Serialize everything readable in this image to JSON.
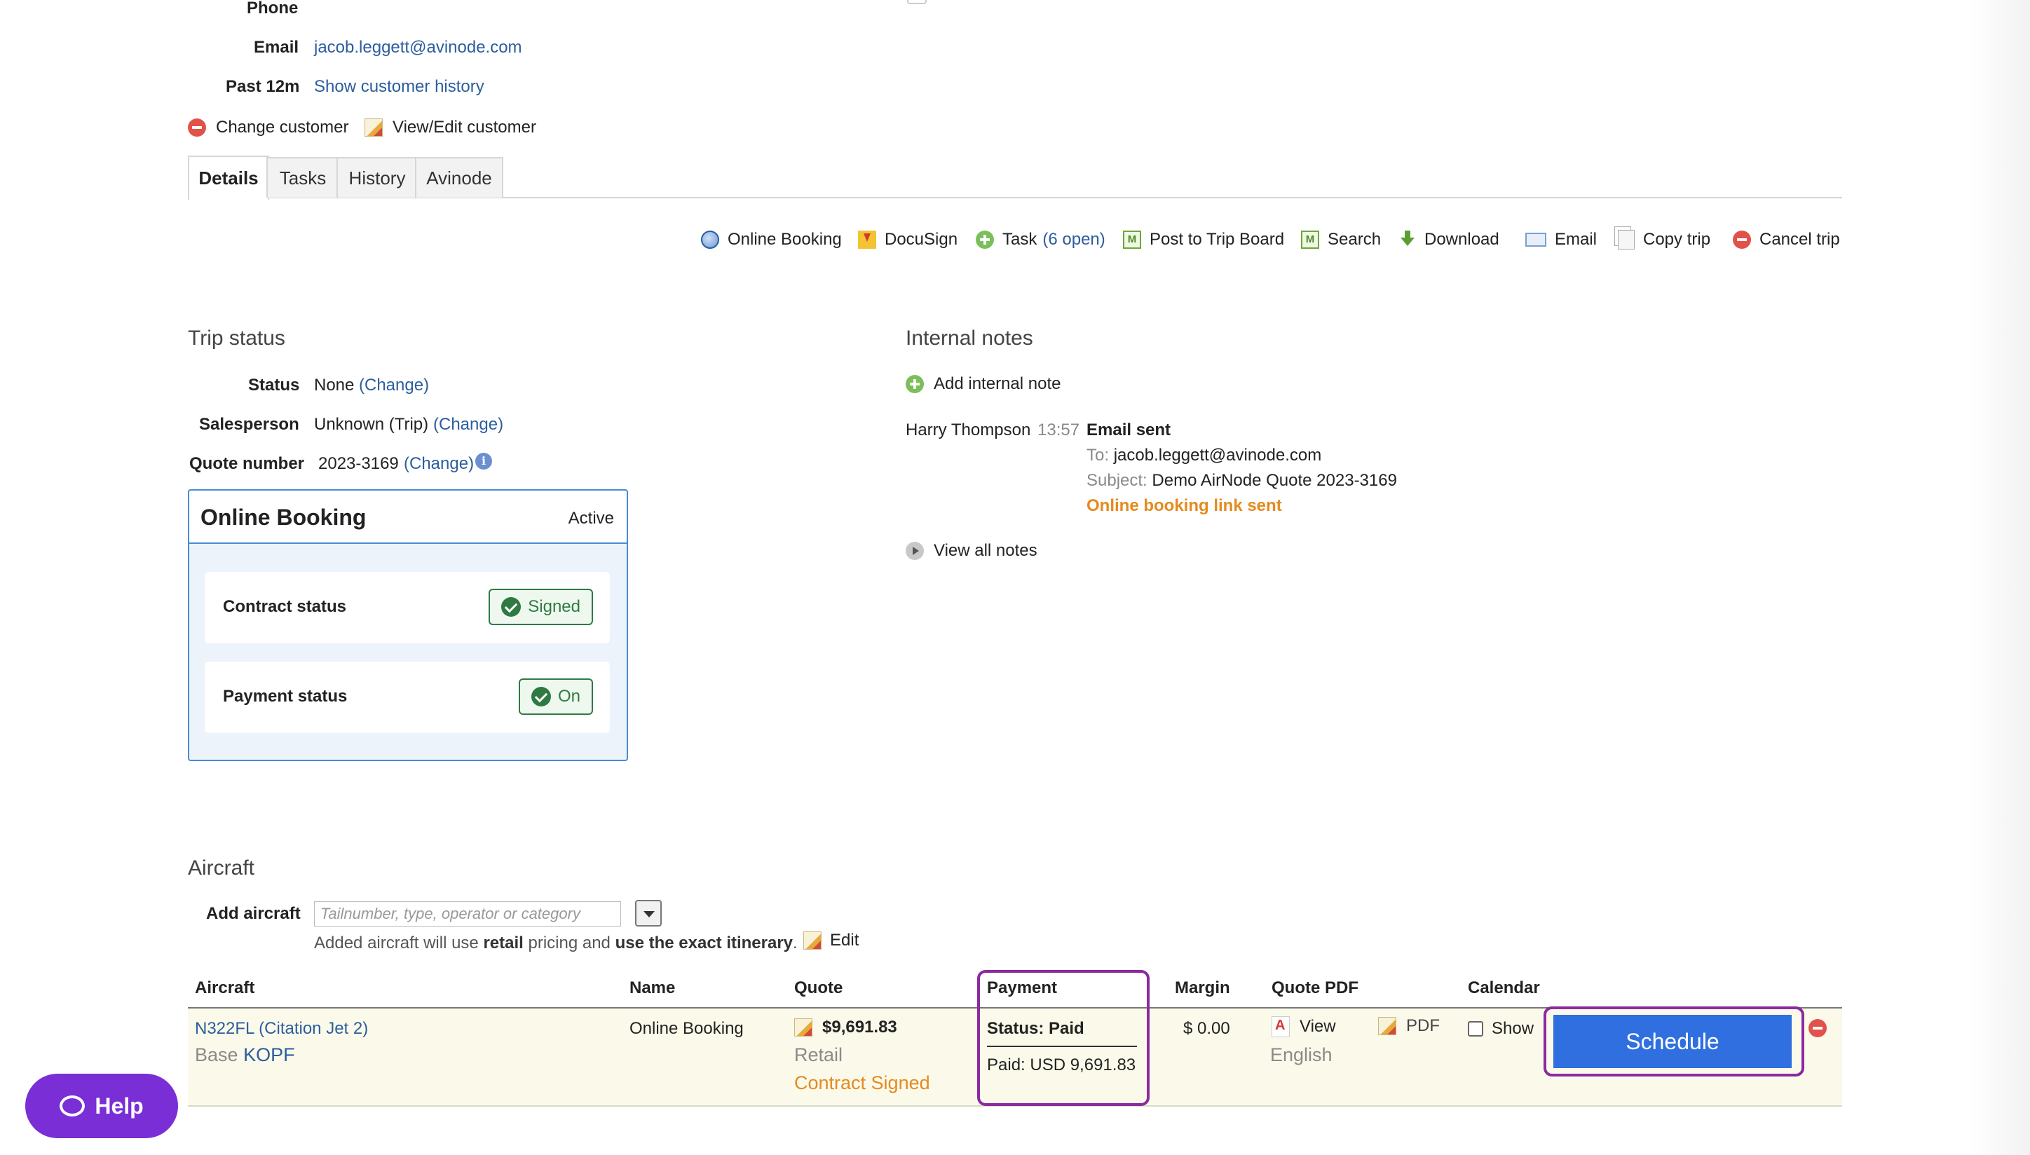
{
  "customer": {
    "phone_label": "Phone",
    "email_label": "Email",
    "email_value": "jacob.leggett@avinode.com",
    "past_label": "Past 12m",
    "history_link": "Show customer history",
    "change_customer": "Change customer",
    "view_edit_customer": "View/Edit customer"
  },
  "tabs": [
    {
      "label": "Details"
    },
    {
      "label": "Tasks"
    },
    {
      "label": "History"
    },
    {
      "label": "Avinode"
    }
  ],
  "toolbar": {
    "online_booking": "Online Booking",
    "docusign": "DocuSign",
    "task": "Task",
    "task_open": "(6 open)",
    "post_trip_board": "Post to Trip Board",
    "search": "Search",
    "download": "Download",
    "email": "Email",
    "copy_trip": "Copy trip",
    "cancel_trip": "Cancel trip"
  },
  "trip_status": {
    "heading": "Trip status",
    "status_label": "Status",
    "status_value": "None",
    "change": "(Change)",
    "salesperson_label": "Salesperson",
    "salesperson_value": "Unknown (Trip)",
    "quote_label": "Quote number",
    "quote_value": "2023-3169"
  },
  "online_booking": {
    "title": "Online Booking",
    "state": "Active",
    "contract_label": "Contract status",
    "contract_value": "Signed",
    "payment_label": "Payment status",
    "payment_value": "On"
  },
  "internal_notes": {
    "heading": "Internal notes",
    "add_note": "Add internal note",
    "author": "Harry Thompson",
    "time": "13:57",
    "note_title": "Email sent",
    "to_label": "To:",
    "to_value": "jacob.leggett@avinode.com",
    "subject_label": "Subject:",
    "subject_value": "Demo AirNode Quote 2023-3169",
    "status_note": "Online booking link sent",
    "view_all": "View all notes"
  },
  "aircraft": {
    "heading": "Aircraft",
    "add_label": "Add aircraft",
    "input_placeholder": "Tailnumber, type, operator or category",
    "hint_prefix": "Added aircraft will use ",
    "hint_retail": "retail",
    "hint_mid": " pricing and ",
    "hint_exact": "use the exact itinerary",
    "hint_suffix": ".",
    "edit": "Edit",
    "columns": {
      "aircraft": "Aircraft",
      "name": "Name",
      "quote": "Quote",
      "payment": "Payment",
      "margin": "Margin",
      "quote_pdf": "Quote PDF",
      "calendar": "Calendar"
    },
    "row": {
      "aircraft_link": "N322FL (Citation Jet 2)",
      "base_label": "Base",
      "base_value": "KOPF",
      "name": "Online Booking",
      "quote_amount": "$9,691.83",
      "quote_type": "Retail",
      "quote_status": "Contract Signed",
      "payment_status": "Status: Paid",
      "payment_paid": "Paid: USD 9,691.83",
      "margin": "$ 0.00",
      "pdf_view": "View",
      "pdf_lang": "English",
      "pdf_label": "PDF",
      "calendar_show": "Show",
      "schedule": "Schedule"
    }
  },
  "help": {
    "label": "Help"
  },
  "colors": {
    "link": "#2c5d9e",
    "orange": "#e58a1f",
    "schedule_button": "#2f6fe0",
    "highlight": "#8b2aa0",
    "help_button": "#7a2ed6",
    "signed_green": "#2f7a43"
  }
}
